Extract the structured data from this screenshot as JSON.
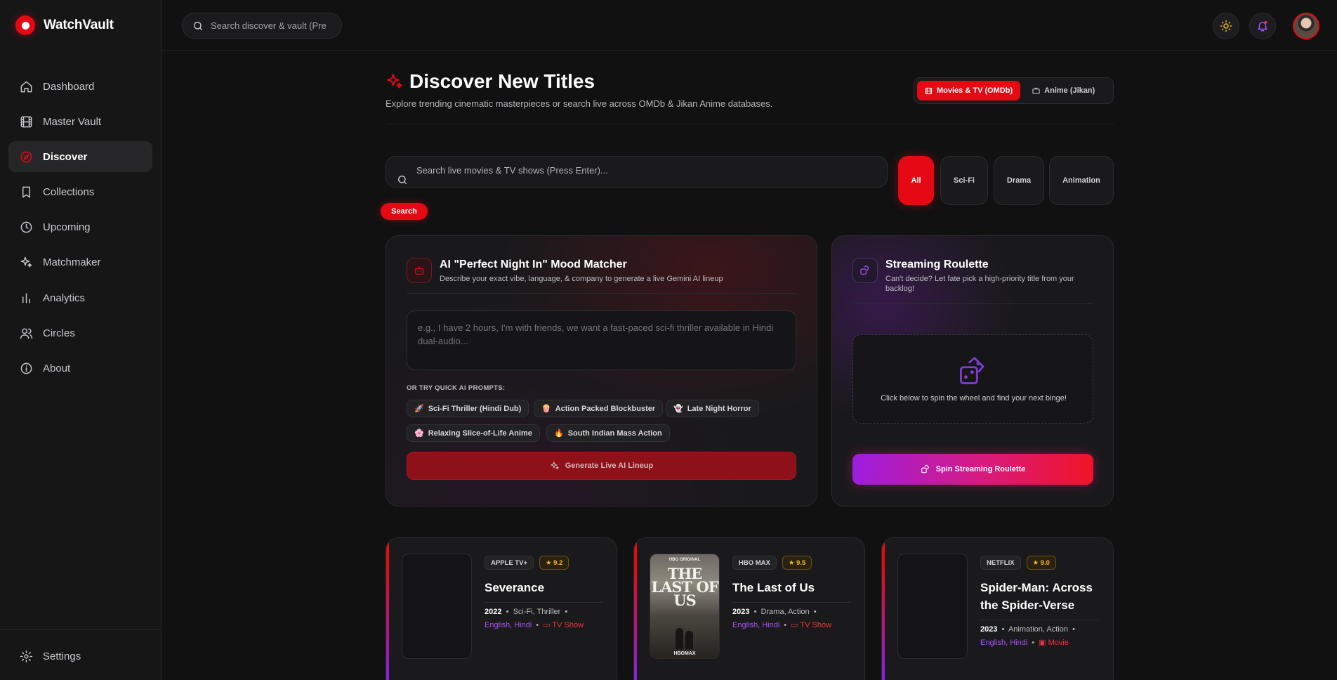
{
  "brand": {
    "name": "WatchVault"
  },
  "nav": {
    "items": [
      {
        "label": "Dashboard",
        "icon": "home-icon"
      },
      {
        "label": "Master Vault",
        "icon": "film-icon"
      },
      {
        "label": "Discover",
        "icon": "compass-icon",
        "active": true
      },
      {
        "label": "Collections",
        "icon": "bookmark-icon"
      },
      {
        "label": "Upcoming",
        "icon": "clock-icon"
      },
      {
        "label": "Matchmaker",
        "icon": "sparkles-icon"
      },
      {
        "label": "Analytics",
        "icon": "bar-chart-icon"
      },
      {
        "label": "Circles",
        "icon": "users-icon"
      },
      {
        "label": "About",
        "icon": "info-icon"
      }
    ],
    "settings": "Settings"
  },
  "topbar": {
    "search_placeholder": "Search discover & vault (Pre"
  },
  "page": {
    "title": "Discover New Titles",
    "subtitle": "Explore trending cinematic masterpieces or search live across OMDb & Jikan Anime databases.",
    "sources": [
      {
        "label": "Movies & TV (OMDb)",
        "active": true
      },
      {
        "label": "Anime (Jikan)",
        "active": false
      }
    ],
    "search_placeholder": "Search live movies & TV shows (Press Enter)...",
    "search_button": "Search",
    "genres": [
      "All",
      "Sci-Fi",
      "Drama",
      "Animation"
    ],
    "active_genre": "All"
  },
  "mood": {
    "title": "AI \"Perfect Night In\" Mood Matcher",
    "subtitle": "Describe your exact vibe, language, & company to generate a live Gemini AI lineup",
    "placeholder": "e.g., I have 2 hours, I'm with friends, we want a fast-paced sci-fi thriller available in Hindi dual-audio...",
    "quick_label": "OR TRY QUICK AI PROMPTS:",
    "prompts": [
      {
        "emoji": "🚀",
        "label": "Sci-Fi Thriller (Hindi Dub)"
      },
      {
        "emoji": "🍿",
        "label": "Action Packed Blockbuster"
      },
      {
        "emoji": "👻",
        "label": "Late Night Horror"
      },
      {
        "emoji": "🌸",
        "label": "Relaxing Slice-of-Life Anime"
      },
      {
        "emoji": "🔥",
        "label": "South Indian Mass Action"
      }
    ],
    "generate_button": "Generate Live AI Lineup"
  },
  "roulette": {
    "title": "Streaming Roulette",
    "subtitle": "Can't decide? Let fate pick a high-priority title from your backlog!",
    "hint": "Click below to spin the wheel and find your next binge!",
    "spin_button": "Spin Streaming Roulette"
  },
  "titles": [
    {
      "platform": "APPLE TV+",
      "rating": "9.2",
      "title": "Severance",
      "year": "2022",
      "genres": "Sci-Fi, Thriller",
      "languages": "English, Hindi",
      "kind": "TV Show"
    },
    {
      "platform": "HBO MAX",
      "rating": "9.5",
      "title": "The Last of Us",
      "year": "2023",
      "genres": "Drama, Action",
      "languages": "English, Hindi",
      "kind": "TV Show",
      "poster_text": "THE LAST OF US",
      "poster_top": "HBO ORIGINAL",
      "poster_foot": "HBOMAX"
    },
    {
      "platform": "NETFLIX",
      "rating": "9.0",
      "title": "Spider-Man: Across the Spider-Verse",
      "year": "2023",
      "genres": "Animation, Action",
      "languages": "English, Hindi",
      "kind": "Movie"
    }
  ],
  "colors": {
    "accent": "#e50914",
    "purple": "#a855f7",
    "star": "#f3b624"
  }
}
